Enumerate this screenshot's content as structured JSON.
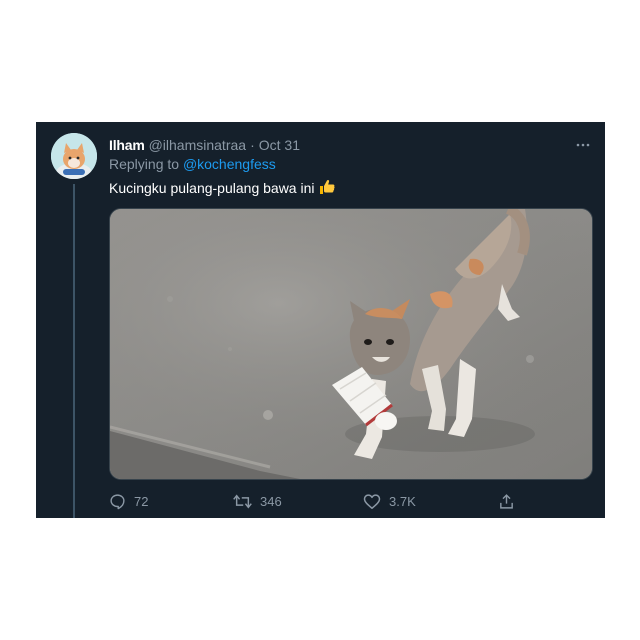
{
  "tweet": {
    "display_name": "Ilham",
    "handle": "@ilhamsinatraa",
    "separator": "·",
    "date": "Oct 31",
    "replying_prefix": "Replying to",
    "replying_to": "@kochengfess",
    "text": "Kucingku pulang-pulang bawa ini",
    "emoji": "👍",
    "media_icon": "cat-with-shuttlecock-photo"
  },
  "actions": {
    "reply_count": "72",
    "retweet_count": "346",
    "like_count": "3.7K"
  },
  "colors": {
    "card_background": "#15202b",
    "text_primary": "#ffffff",
    "text_secondary": "#8b98a5",
    "link": "#1d9bf0"
  }
}
